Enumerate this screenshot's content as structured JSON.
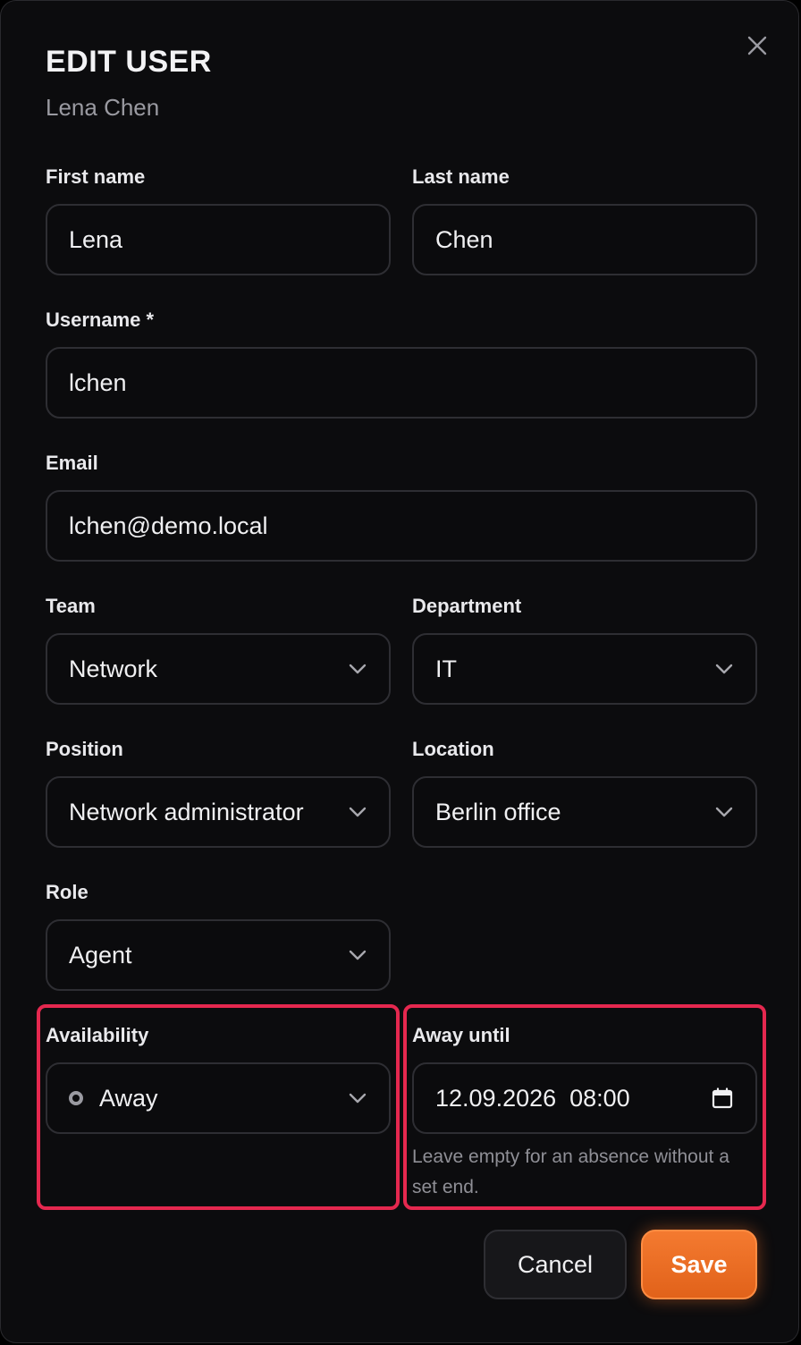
{
  "dialog": {
    "title": "EDIT USER",
    "subtitle": "Lena Chen",
    "close_icon": "close-icon"
  },
  "fields": {
    "first_name": {
      "label": "First name",
      "value": "Lena"
    },
    "last_name": {
      "label": "Last name",
      "value": "Chen"
    },
    "username": {
      "label": "Username *",
      "value": "lchen"
    },
    "email": {
      "label": "Email",
      "value": "lchen@demo.local"
    },
    "team": {
      "label": "Team",
      "value": "Network"
    },
    "department": {
      "label": "Department",
      "value": "IT"
    },
    "position": {
      "label": "Position",
      "value": "Network administrator"
    },
    "location": {
      "label": "Location",
      "value": "Berlin office"
    },
    "role": {
      "label": "Role",
      "value": "Agent"
    },
    "availability": {
      "label": "Availability",
      "value": "Away",
      "status_icon": "status-circle-icon"
    },
    "away_until": {
      "label": "Away until",
      "value": "12.09.2026  08:00",
      "hint": "Leave empty for an absence without a set end.",
      "icon": "calendar-icon"
    }
  },
  "actions": {
    "cancel_label": "Cancel",
    "save_label": "Save"
  },
  "colors": {
    "background": "#0c0c0e",
    "highlight": "#e5284f",
    "accent": "#f07028"
  }
}
